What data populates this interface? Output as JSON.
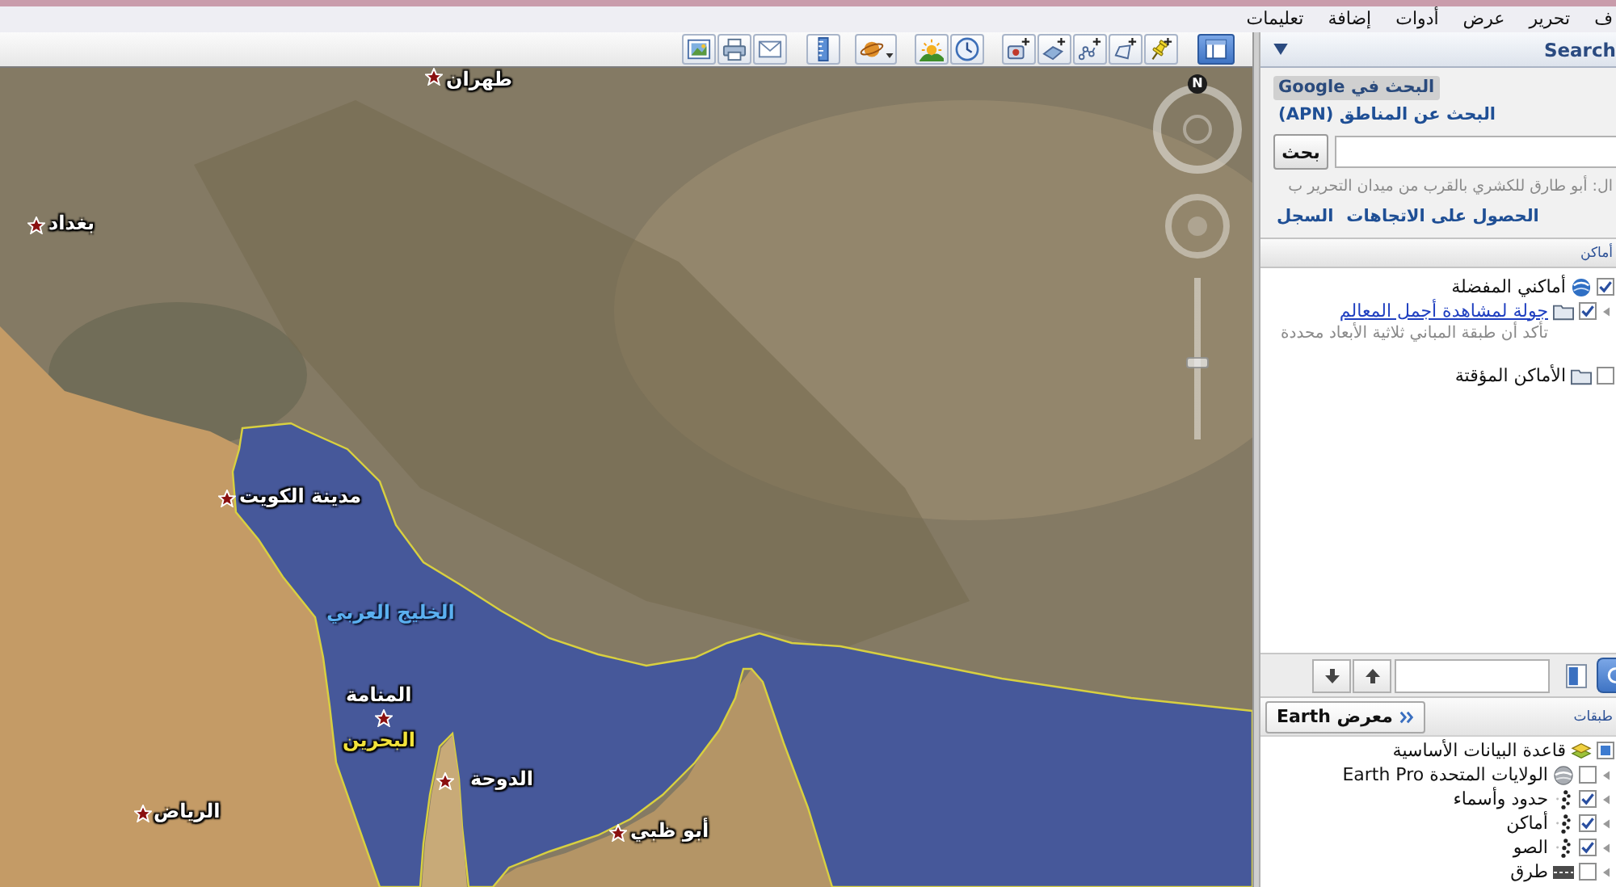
{
  "menu": [
    {
      "label": "ف"
    },
    {
      "label": "تحرير"
    },
    {
      "label": "عرض"
    },
    {
      "label": "أدوات"
    },
    {
      "label": "إضافة"
    },
    {
      "label": "تعليمات"
    }
  ],
  "toolbar": {
    "sidebar_on": true
  },
  "map": {
    "compass_label": "N",
    "zoom_slider": {
      "level": 0.47
    },
    "placemarks": [
      {
        "label": "طهران",
        "kind": "city"
      },
      {
        "label": "بغداد",
        "kind": "city"
      },
      {
        "label": "مدينة الكويت",
        "kind": "city"
      },
      {
        "label": "الخليج العربي",
        "kind": "water"
      },
      {
        "label": "المنامة",
        "kind": "city"
      },
      {
        "label": "البحرين",
        "kind": "country"
      },
      {
        "label": "الدوحة",
        "kind": "city"
      },
      {
        "label": "الرياض",
        "kind": "city"
      },
      {
        "label": "أبو ظبي",
        "kind": "city"
      }
    ]
  },
  "search_panel": {
    "title": "Search",
    "tabs": [
      {
        "label": "البحث في Google",
        "selected": true
      },
      {
        "label": "البحث عن المناطق (APN)",
        "selected": false
      }
    ],
    "button": "بحث",
    "example": "ال: أبو طارق للكشري بالقرب من ميدان التحرير ب",
    "links": [
      "الحصول على الاتجاهات",
      "السجل"
    ]
  },
  "places": {
    "title": "أماكن",
    "items": [
      {
        "label": "أماكني المفضلة",
        "kind": "places",
        "checked": true,
        "children": [
          {
            "label": "جولة لمشاهدة أجمل المعالم",
            "kind": "tour",
            "checked": true,
            "expanded": false,
            "description": "تأكد أن طبقة المباني ثلاثية الأبعاد محددة"
          }
        ]
      },
      {
        "label": "الأماكن المؤقتة",
        "kind": "folder",
        "checked": false
      }
    ]
  },
  "layers": {
    "title": "طبقات",
    "gallery_button": "معرض Earth",
    "items": [
      {
        "label": "قاعدة البيانات الأساسية",
        "kind": "database",
        "partial": true,
        "children": [
          {
            "label": "الولايات المتحدة Earth Pro",
            "kind": "globe",
            "checked": false,
            "expanded": false
          },
          {
            "label": "حدود وأسماء",
            "kind": "dots",
            "checked": true,
            "expanded": false
          },
          {
            "label": "أماكن",
            "kind": "dots",
            "checked": true,
            "expanded": false
          },
          {
            "label": "الصو",
            "kind": "dots",
            "checked": true,
            "expanded": false
          },
          {
            "label": "طرق",
            "kind": "road",
            "checked": false,
            "expanded": false
          }
        ]
      }
    ]
  }
}
